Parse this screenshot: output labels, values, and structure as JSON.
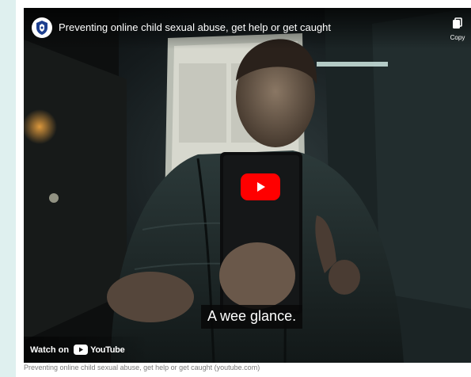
{
  "video": {
    "title": "Preventing online child sexual abuse, get help or get caught",
    "copy_label": "Copy",
    "subtitle": "A wee glance.",
    "watch_on_label": "Watch on",
    "youtube_wordmark": "YouTube",
    "play_icon": "play-icon",
    "channel_logo_icon": "police-crest-icon",
    "copy_icon": "copy-link-icon",
    "accent_color": "#ff0000"
  },
  "caption": {
    "text": "Preventing online child sexual abuse, get help or get caught (youtube.com)"
  }
}
